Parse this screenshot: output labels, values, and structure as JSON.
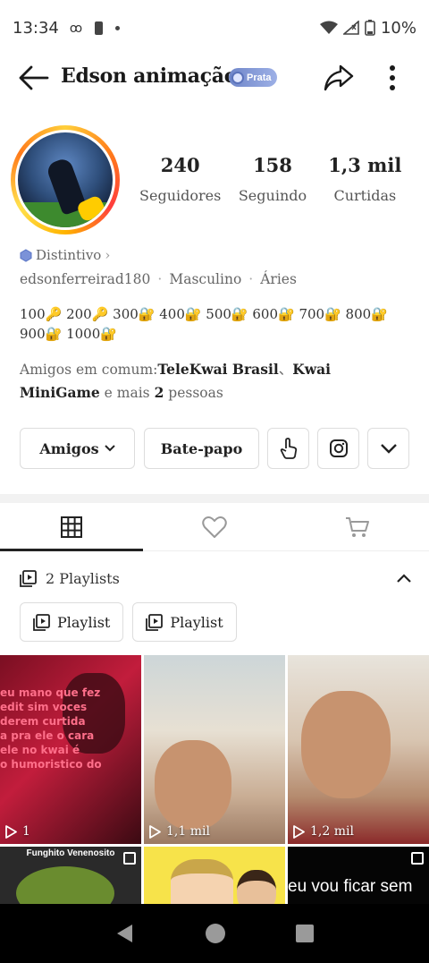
{
  "status_bar": {
    "time": "13:34",
    "battery": "10%"
  },
  "header": {
    "name": "Edson animação",
    "badge": "Prata"
  },
  "stats": [
    {
      "value": "240",
      "label": "Seguidores"
    },
    {
      "value": "158",
      "label": "Seguindo"
    },
    {
      "value": "1,3 mil",
      "label": "Curtidas"
    }
  ],
  "profile": {
    "distintivo": "Distintivo",
    "username": "edsonferreirad180",
    "gender": "Masculino",
    "sign": "Áries",
    "bio_line1": "100🔑  200🔑 300🔐  400🔐  500🔐  600🔐 700🔐  800🔐",
    "bio_line2": "900🔐  1000🔐",
    "mutual_prefix": "Amigos em comum:",
    "mutual_friend1": "TeleKwai Brasil",
    "mutual_sep": "、",
    "mutual_friend2": "Kwai MiniGame",
    "mutual_suffix1": " e mais ",
    "mutual_count": "2",
    "mutual_suffix2": " pessoas"
  },
  "actions": {
    "friends": "Amigos",
    "chat": "Bate-papo"
  },
  "playlists": {
    "header": "2 Playlists",
    "items": [
      "Playlist",
      "Playlist"
    ]
  },
  "videos": [
    {
      "views": "1",
      "overlay": "eu mano que fez\nedit sim voces\nderem curtida\na pra ele o cara\nele no kwai é\no humoristico do"
    },
    {
      "views": "1,1 mil"
    },
    {
      "views": "1,2 mil"
    },
    {
      "title": "Funghito Venenosito"
    },
    {},
    {
      "subtitle": "eu vou ficar sem"
    }
  ],
  "icons": {
    "back": "arrow-left-icon",
    "share": "share-icon",
    "more": "more-vertical-icon",
    "grid": "grid-icon",
    "likes": "heart-icon",
    "shop": "cart-icon"
  }
}
